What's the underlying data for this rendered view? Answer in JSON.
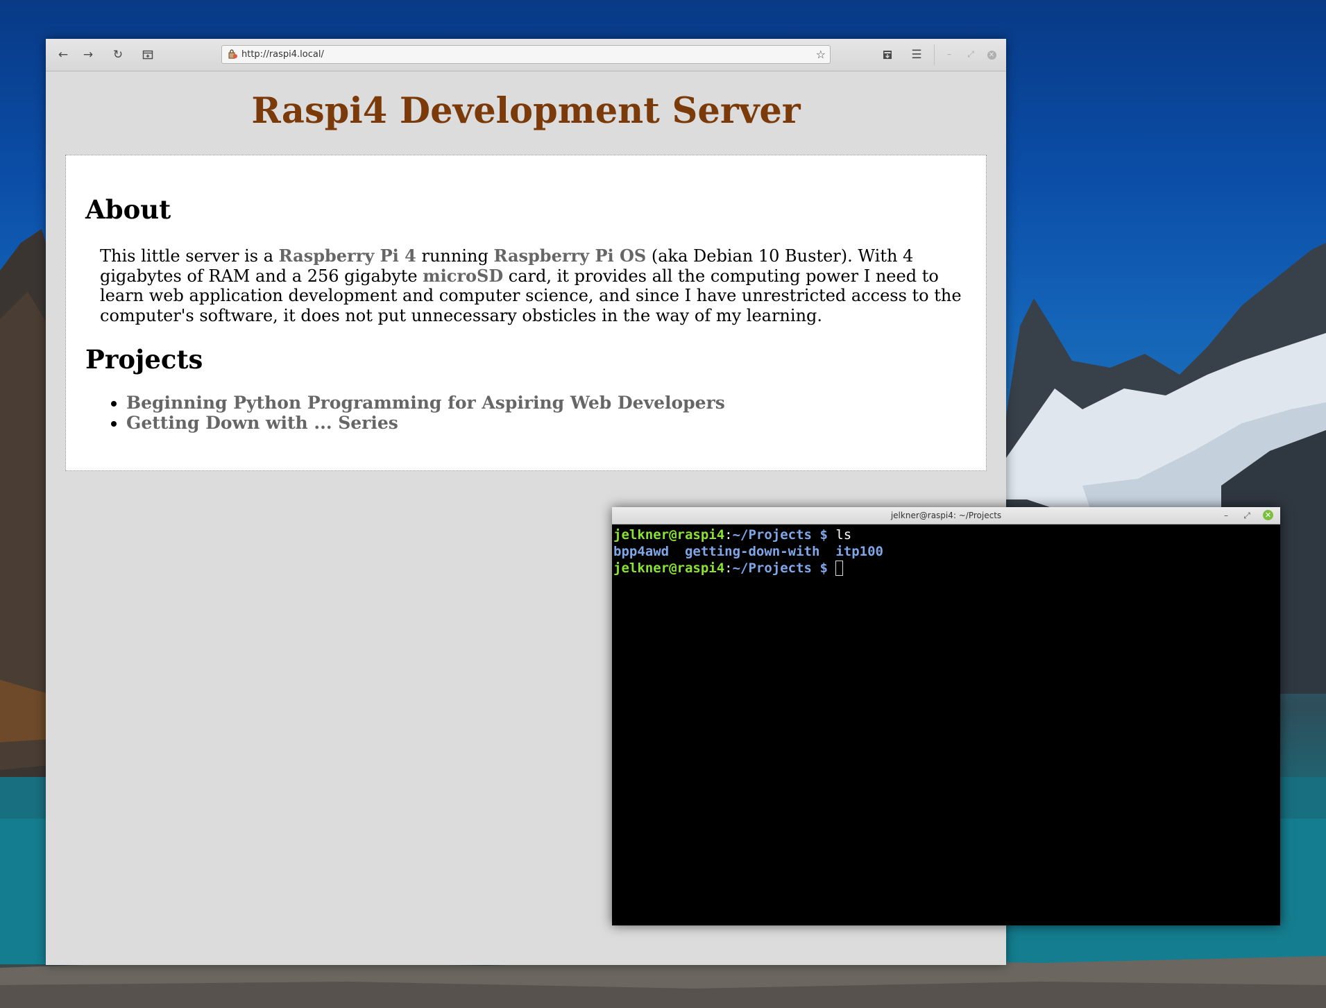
{
  "browser": {
    "url": "http://raspi4.local/",
    "page": {
      "title": "Raspi4 Development Server",
      "about_heading": "About",
      "about_text": {
        "t1": "This little server is a ",
        "link1": "Raspberry Pi 4",
        "t2": " running ",
        "link2": "Raspberry Pi OS",
        "t3": " (aka Debian 10 Buster). With 4 gigabytes of RAM and a 256 gigabyte ",
        "link3": "microSD",
        "t4": " card, it provides all the computing power I need to learn web application development and computer science, and since I have unrestricted access to the computer's software, it does not put unnecessary obsticles in the way of my learning."
      },
      "projects_heading": "Projects",
      "projects": [
        "Beginning Python Programming for Aspiring Web Developers",
        "Getting Down with ... Series"
      ]
    }
  },
  "terminal": {
    "title": "jelkner@raspi4: ~/Projects",
    "lines": {
      "l1_user": "jelkner@raspi4",
      "l1_sep": ":",
      "l1_path": "~/Projects",
      "l1_prompt": " $ ",
      "l1_cmd": "ls",
      "l2_dir1": "bpp4awd",
      "l2_dir2": "getting-down-with",
      "l2_dir3": "itp100",
      "l3_user": "jelkner@raspi4",
      "l3_sep": ":",
      "l3_path": "~/Projects",
      "l3_prompt": " $ "
    }
  },
  "colors": {
    "title_brown": "#7b3a09",
    "link_gray": "#666666",
    "term_user_green": "#8ae234",
    "term_path_blue": "#7fa7e8"
  }
}
